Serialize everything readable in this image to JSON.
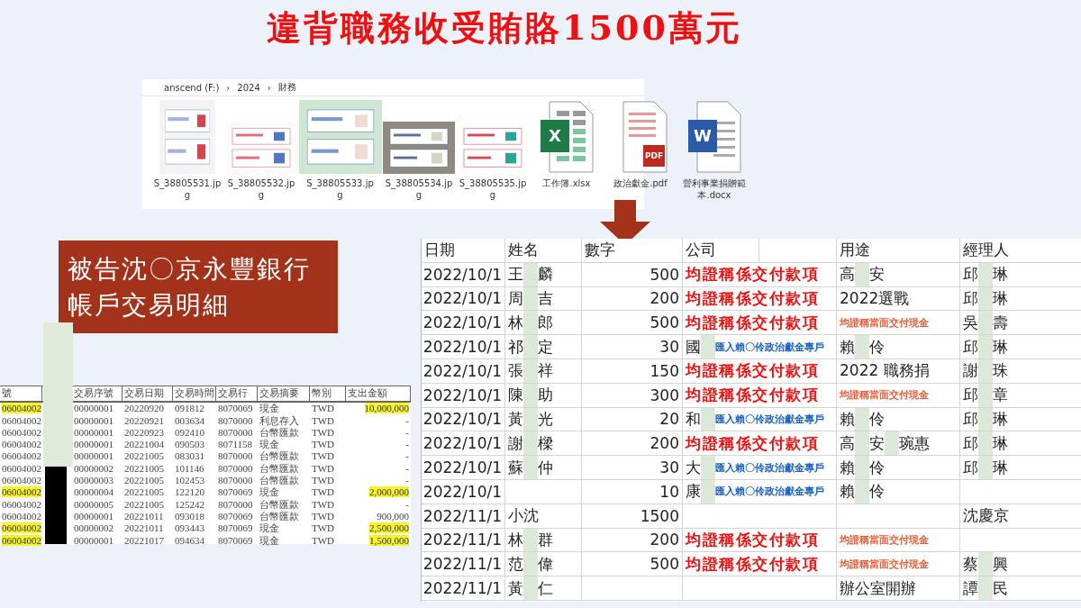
{
  "title": "違背職務收受賄賂1500萬元",
  "explorer": {
    "breadcrumb": [
      "anscend (F:)",
      "2024",
      "財務"
    ],
    "separator": "›",
    "files": [
      {
        "name": "S_38805531.jpg"
      },
      {
        "name": "S_38805532.jpg"
      },
      {
        "name": "S_38805533.jpg"
      },
      {
        "name": "S_38805534.jpg"
      },
      {
        "name": "S_38805535.jpg"
      },
      {
        "kind": "excel",
        "name": "工作簿.xlsx",
        "badge": "X"
      },
      {
        "kind": "pdf",
        "name": "政治獻金.pdf",
        "badge": "PDF"
      },
      {
        "kind": "word",
        "name": "營利事業捐贈範本.docx",
        "badge": "W"
      }
    ]
  },
  "caption": "被告沈〇京永豐銀行帳戶交易明細",
  "bank_table": {
    "columns": [
      "號",
      "交易序號",
      "交易日期",
      "交易時間",
      "交易行",
      "交易摘要",
      "幣別",
      "支出金額"
    ],
    "rows": [
      {
        "highlighted": true,
        "cells": [
          "06004002",
          "00000001",
          "20220920",
          "091812",
          "8070069",
          "現金",
          "TWD",
          "10,000,000"
        ]
      },
      {
        "highlighted": false,
        "cells": [
          "06004002",
          "00000001",
          "20220921",
          "003634",
          "8070000",
          "利息存入",
          "TWD",
          "-"
        ]
      },
      {
        "highlighted": false,
        "cells": [
          "06004002",
          "00000001",
          "20220923",
          "092410",
          "8070000",
          "台幣匯款",
          "TWD",
          "-"
        ]
      },
      {
        "highlighted": false,
        "cells": [
          "06004002",
          "00000001",
          "20221004",
          "090503",
          "8071158",
          "現金",
          "TWD",
          "-"
        ]
      },
      {
        "highlighted": false,
        "cells": [
          "06004002",
          "00000001",
          "20221005",
          "083031",
          "8070000",
          "台幣匯款",
          "TWD",
          "-"
        ]
      },
      {
        "highlighted": false,
        "cells": [
          "06004002",
          "00000002",
          "20221005",
          "101146",
          "8070000",
          "台幣匯款",
          "TWD",
          "-"
        ]
      },
      {
        "highlighted": false,
        "cells": [
          "06004002",
          "00000003",
          "20221005",
          "102453",
          "8070000",
          "台幣匯款",
          "TWD",
          "-"
        ]
      },
      {
        "highlighted": true,
        "cells": [
          "06004002",
          "00000004",
          "20221005",
          "122120",
          "8070069",
          "現金",
          "TWD",
          "2,000,000"
        ]
      },
      {
        "highlighted": false,
        "cells": [
          "06004002",
          "00000005",
          "20221005",
          "125242",
          "8070000",
          "台幣匯款",
          "TWD",
          "-"
        ]
      },
      {
        "highlighted": false,
        "cells": [
          "06004002",
          "00000001",
          "20221011",
          "093018",
          "8070069",
          "台幣匯款",
          "TWD",
          "900,000"
        ]
      },
      {
        "highlighted": true,
        "cells": [
          "06004002",
          "00000002",
          "20221011",
          "093443",
          "8070069",
          "現金",
          "TWD",
          "2,500,000"
        ]
      },
      {
        "highlighted": true,
        "cells": [
          "06004002",
          "00000001",
          "20221017",
          "094634",
          "8070069",
          "現金",
          "TWD",
          "1,500,000"
        ]
      }
    ]
  },
  "sheet": {
    "columns": [
      "日期",
      "姓名",
      "數字",
      "公司",
      "用途",
      "經理人"
    ],
    "rows": [
      {
        "date": "2022/10/1",
        "name": [
          "王",
          "麟"
        ],
        "amount": "500",
        "remark": {
          "kind": "statement",
          "text": "均證稱係交付款項"
        },
        "purpose": {
          "kind": "plain",
          "parts": [
            "高",
            "安"
          ]
        },
        "manager": [
          "邱",
          "琳"
        ]
      },
      {
        "date": "2022/10/1",
        "name": [
          "周",
          "吉"
        ],
        "amount": "200",
        "remark": {
          "kind": "statement",
          "text": "均證稱係交付款項"
        },
        "purpose": {
          "kind": "plain",
          "parts": [
            "2022選戰"
          ]
        },
        "manager": [
          "邱",
          "琳"
        ]
      },
      {
        "date": "2022/10/1",
        "name": [
          "林",
          "郎"
        ],
        "amount": "500",
        "remark": {
          "kind": "statement",
          "text": "均證稱係交付款項"
        },
        "purpose": {
          "kind": "cash",
          "parts": [
            "均證稱當面交付現金"
          ]
        },
        "manager": [
          "吳",
          "壽"
        ]
      },
      {
        "date": "2022/10/1",
        "name": [
          "祁",
          "定"
        ],
        "amount": "30",
        "company": [
          "國"
        ],
        "remark": {
          "kind": "transfer",
          "text": "匯入賴〇伶政治獻金專戶"
        },
        "purpose": {
          "kind": "plain",
          "parts": [
            "賴",
            "伶"
          ]
        },
        "manager": [
          "邱",
          "琳"
        ]
      },
      {
        "date": "2022/10/1",
        "name": [
          "張",
          "祥"
        ],
        "amount": "150",
        "remark": {
          "kind": "statement",
          "text": "均證稱係交付款項"
        },
        "purpose": {
          "kind": "plain",
          "parts": [
            "2022 職務捐"
          ]
        },
        "manager": [
          "謝",
          "珠"
        ]
      },
      {
        "date": "2022/10/1",
        "name": [
          "陳",
          "助"
        ],
        "amount": "300",
        "remark": {
          "kind": "statement",
          "text": "均證稱係交付款項"
        },
        "purpose": {
          "kind": "cash",
          "parts": [
            "均證稱當面交付現金"
          ]
        },
        "manager": [
          "邱",
          "章"
        ]
      },
      {
        "date": "2022/10/1",
        "name": [
          "黃",
          "光"
        ],
        "amount": "20",
        "company": [
          "和"
        ],
        "remark": {
          "kind": "transfer",
          "text": "匯入賴〇伶政治獻金專戶"
        },
        "purpose": {
          "kind": "plain",
          "parts": [
            "賴",
            "伶"
          ]
        },
        "manager": [
          "邱",
          "琳"
        ]
      },
      {
        "date": "2022/10/1",
        "name": [
          "謝",
          "樑"
        ],
        "amount": "200",
        "remark": {
          "kind": "statement",
          "text": "均證稱係交付款項"
        },
        "purpose": {
          "kind": "plain",
          "parts": [
            "高",
            "安",
            "琬惠"
          ]
        },
        "manager": [
          "邱",
          "琳"
        ]
      },
      {
        "date": "2022/10/1",
        "name": [
          "蘇",
          "仲"
        ],
        "amount": "30",
        "company": [
          "大"
        ],
        "remark": {
          "kind": "transfer",
          "text": "匯入賴〇伶政治獻金專戶"
        },
        "purpose": {
          "kind": "plain",
          "parts": [
            "賴",
            "伶"
          ]
        },
        "manager": [
          "邱",
          "琳"
        ]
      },
      {
        "date": "2022/10/1",
        "amount": "10",
        "company": [
          "康"
        ],
        "remark": {
          "kind": "transfer",
          "text": "匯入賴〇伶政治獻金專戶"
        },
        "purpose": {
          "kind": "plain",
          "parts": [
            "賴",
            "伶"
          ]
        }
      },
      {
        "date": "2022/11/1",
        "name": [
          "小沈"
        ],
        "amount": "1500",
        "manager": [
          "沈慶京"
        ]
      },
      {
        "date": "2022/11/1",
        "name": [
          "林",
          "群"
        ],
        "amount": "200",
        "remark": {
          "kind": "statement",
          "text": "均證稱係交付款項"
        },
        "purpose": {
          "kind": "cash",
          "parts": [
            "均證稱當面交付現金"
          ]
        }
      },
      {
        "date": "2022/11/1",
        "name": [
          "范",
          "偉"
        ],
        "amount": "500",
        "remark": {
          "kind": "statement",
          "text": "均證稱係交付款項"
        },
        "purpose": {
          "kind": "cash",
          "parts": [
            "均證稱當面交付現金"
          ]
        },
        "manager": [
          "蔡",
          "興"
        ]
      },
      {
        "date": "2022/11/1",
        "name": [
          "黃",
          "仁"
        ],
        "purpose": {
          "kind": "plain",
          "parts": [
            "辦公室開辦"
          ]
        },
        "manager": [
          "譚",
          "民"
        ]
      }
    ]
  }
}
